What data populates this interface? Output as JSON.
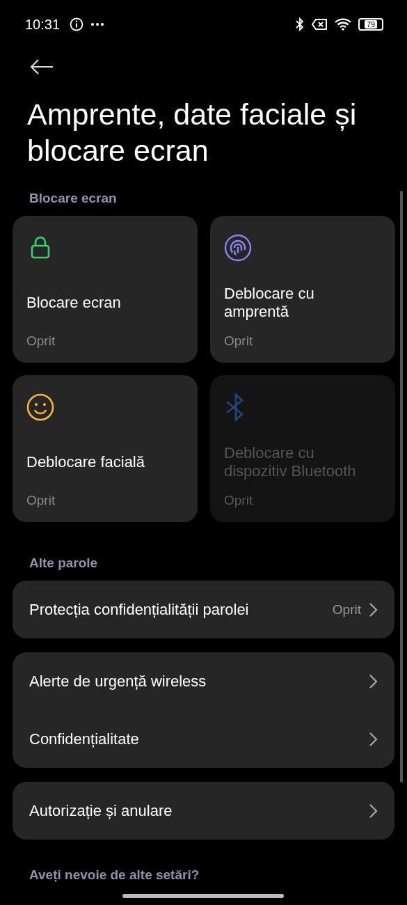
{
  "status_bar": {
    "time": "10:31",
    "battery": "79"
  },
  "title": "Amprente, date faciale și blocare ecran",
  "sections": [
    {
      "label": "Blocare ecran",
      "tiles": [
        {
          "kind": "lock",
          "label": "Blocare ecran",
          "value": "Oprit",
          "disabled": false
        },
        {
          "kind": "fingerprint",
          "label": "Deblocare cu amprentă",
          "value": "Oprit",
          "disabled": false
        },
        {
          "kind": "face",
          "label": "Deblocare facială",
          "value": "Oprit",
          "disabled": false
        },
        {
          "kind": "bluetooth",
          "label": "Deblocare cu dispozitiv Bluetooth",
          "value": "Oprit",
          "disabled": true
        }
      ]
    },
    {
      "label": "Alte parole",
      "groups": [
        [
          {
            "label": "Protecția confidențialității parolei",
            "value": "Oprit"
          }
        ],
        [
          {
            "label": "Alerte de urgență wireless"
          },
          {
            "label": "Confidențialitate"
          }
        ],
        [
          {
            "label": "Autorizație și anulare"
          }
        ]
      ]
    }
  ],
  "footer": "Aveți nevoie de alte setări?"
}
